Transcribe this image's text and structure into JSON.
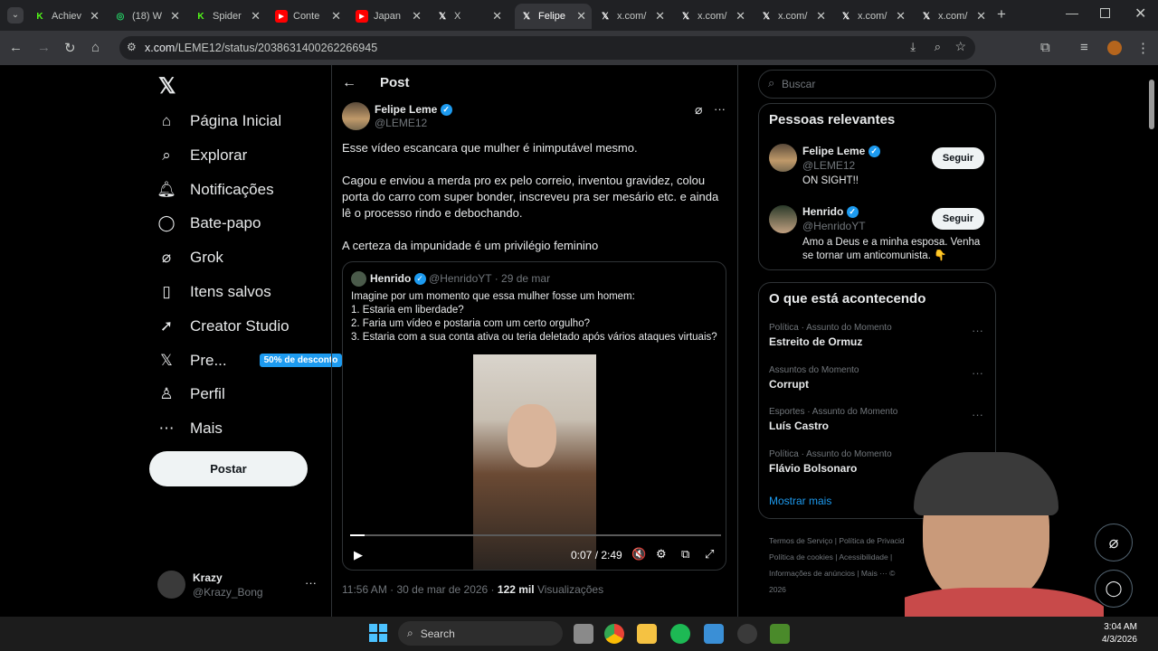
{
  "browser": {
    "tabs": [
      {
        "title": "Achiev",
        "icon": "kick-icon",
        "color": "#53fc18"
      },
      {
        "title": "(18) W",
        "icon": "whatsapp-icon",
        "color": "#25d366"
      },
      {
        "title": "Spider",
        "icon": "kick-icon",
        "color": "#53fc18"
      },
      {
        "title": "Conte",
        "icon": "youtube-icon",
        "color": "#ff0000"
      },
      {
        "title": "Japan",
        "icon": "youtube-icon",
        "color": "#ff0000"
      },
      {
        "title": "X",
        "icon": "x-icon",
        "color": "#ffffff"
      },
      {
        "title": "Felipe",
        "icon": "x-icon",
        "color": "#ffffff"
      },
      {
        "title": "x.com/",
        "icon": "x-icon",
        "color": "#ffffff"
      },
      {
        "title": "x.com/",
        "icon": "x-icon",
        "color": "#ffffff"
      },
      {
        "title": "x.com/",
        "icon": "x-icon",
        "color": "#ffffff"
      },
      {
        "title": "x.com/",
        "icon": "x-icon",
        "color": "#ffffff"
      },
      {
        "title": "x.com/",
        "icon": "x-icon",
        "color": "#ffffff"
      }
    ],
    "url_domain": "x.com",
    "url_path": "/LEME12/status/2038631400262266945"
  },
  "sidebar": {
    "items": [
      {
        "label": "Página Inicial",
        "icon": "home-icon"
      },
      {
        "label": "Explorar",
        "icon": "search-icon"
      },
      {
        "label": "Notificações",
        "icon": "bell-icon"
      },
      {
        "label": "Bate-papo",
        "icon": "chat-icon"
      },
      {
        "label": "Grok",
        "icon": "grok-icon"
      },
      {
        "label": "Itens salvos",
        "icon": "bookmark-icon"
      },
      {
        "label": "Creator Studio",
        "icon": "rocket-icon"
      },
      {
        "label": "Pre...",
        "icon": "x-icon"
      },
      {
        "label": "Perfil",
        "icon": "person-icon"
      },
      {
        "label": "Mais",
        "icon": "more-circle-icon"
      }
    ],
    "premium_badge": "50% de desconto",
    "post_button": "Postar",
    "account": {
      "name": "Krazy",
      "handle": "@Krazy_Bong"
    }
  },
  "header": {
    "title": "Post"
  },
  "post": {
    "author": "Felipe Leme",
    "handle": "@LEME12",
    "text1": "Esse vídeo escancara que mulher é inimputável mesmo.",
    "text2a": "Cagou e enviou a merda pro ex pelo correio, inventou gravidez, colou",
    "text2b": "porta do carro com super bonder, inscreveu pra ser mesário etc. e ainda",
    "text2c": "lê o processo rindo e debochando.",
    "text3": "A certeza da impunidade é um privilégio feminino",
    "timestamp": "11:56 AM · 30 de mar de 2026 ·",
    "views": "122 mil",
    "views_label": "Visualizações"
  },
  "quote": {
    "author": "Henrido",
    "handle": "@HenridoYT",
    "date": "· 29 de mar",
    "line1": "Imagine por um momento que essa mulher fosse um homem:",
    "line2": "1. Estaria em liberdade?",
    "line3": "2. Faria um vídeo e postaria com um certo orgulho?",
    "line4": "3. Estaria com a sua conta ativa ou teria deletado após vários ataques virtuais?",
    "video_time": "0:07 / 2:49",
    "video_progress": 0.04
  },
  "search": {
    "placeholder": "Buscar"
  },
  "relevant": {
    "title": "Pessoas relevantes",
    "people": [
      {
        "name": "Felipe Leme",
        "handle": "@LEME12",
        "bio": "ON SIGHT!!",
        "button": "Seguir"
      },
      {
        "name": "Henrido",
        "handle": "@HenridoYT",
        "bio1": "Amo a Deus e a minha esposa. Venha",
        "bio2": "se tornar um anticomunista. 👇",
        "button": "Seguir"
      }
    ]
  },
  "trends": {
    "title": "O que está acontecendo",
    "items": [
      {
        "category": "Política · Assunto do Momento",
        "name": "Estreito de Ormuz"
      },
      {
        "category": "Assuntos do Momento",
        "name": "Corrupt"
      },
      {
        "category": "Esportes · Assunto do Momento",
        "name": "Luís Castro"
      },
      {
        "category": "Política · Assunto do Momento",
        "name": "Flávio Bolsonaro"
      }
    ],
    "show_more": "Mostrar mais"
  },
  "footer": {
    "l1": "Termos de Serviço",
    "l2": "Política de Privacid",
    "l3": "Política de cookies",
    "l4": "Acessibilidade",
    "l5": "Informações de anúncios",
    "l6": "Mais ···",
    "l7": "© 2026"
  },
  "taskbar": {
    "search": "Search",
    "time": "3:04 AM",
    "date": "4/3/2026"
  }
}
